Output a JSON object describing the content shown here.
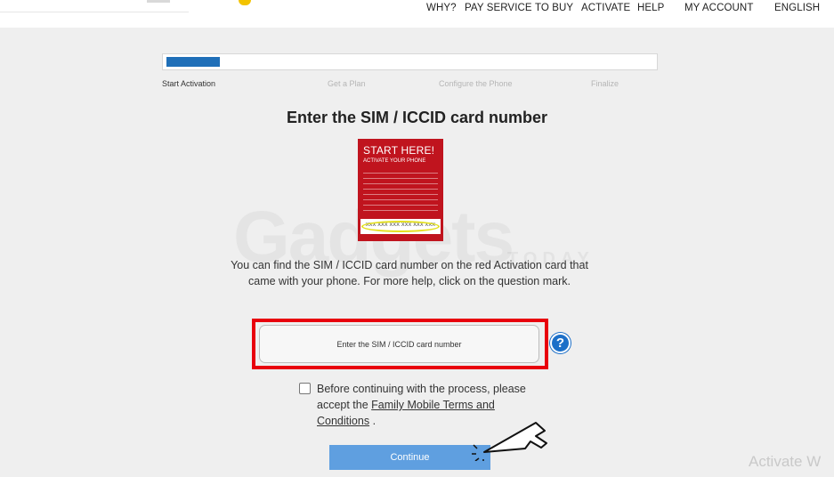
{
  "nav": {
    "items": [
      {
        "label": "WHY?"
      },
      {
        "label": "PAY SERVICE"
      },
      {
        "label": "TO BUY"
      },
      {
        "label": "ACTIVATE"
      },
      {
        "label": "HELP"
      },
      {
        "label": "MY ACCOUNT"
      },
      {
        "label": "ENGLISH"
      }
    ]
  },
  "progress": {
    "value": 0.11,
    "steps": [
      {
        "label": "Start Activation",
        "state": "active"
      },
      {
        "label": "Get a Plan",
        "state": "inactive"
      },
      {
        "label": "Configure the Phone",
        "state": "inactive"
      },
      {
        "label": "Finalize",
        "state": "inactive"
      }
    ]
  },
  "main": {
    "heading": "Enter the SIM / ICCID card number",
    "card": {
      "title": "START HERE!",
      "subtitle": "ACTIVATE YOUR PHONE",
      "code": "XXX XXX XXX XXX XXX XXX"
    },
    "help_text": "You can find the SIM / ICCID card number on the red Activation card that came with your phone. For more help, click on the question mark.",
    "sim_input": {
      "placeholder": "Enter the SIM / ICCID card number",
      "value": ""
    },
    "help_button": "?",
    "terms": {
      "prefix": "Before continuing with the process, please accept the",
      "link": "Family Mobile Terms and Conditions",
      "suffix": "."
    },
    "continue_label": "Continue"
  },
  "watermark": {
    "text": "Gadgets",
    "sub": "TODAY"
  },
  "os_overlay": {
    "activate_text": "Activate W"
  },
  "colors": {
    "progress_fill": "#1f6fb8",
    "highlight": "#e8000d",
    "card": "#c0141e",
    "continue_button": "#5f9fe0",
    "help_icon": "#1c6fc8"
  }
}
